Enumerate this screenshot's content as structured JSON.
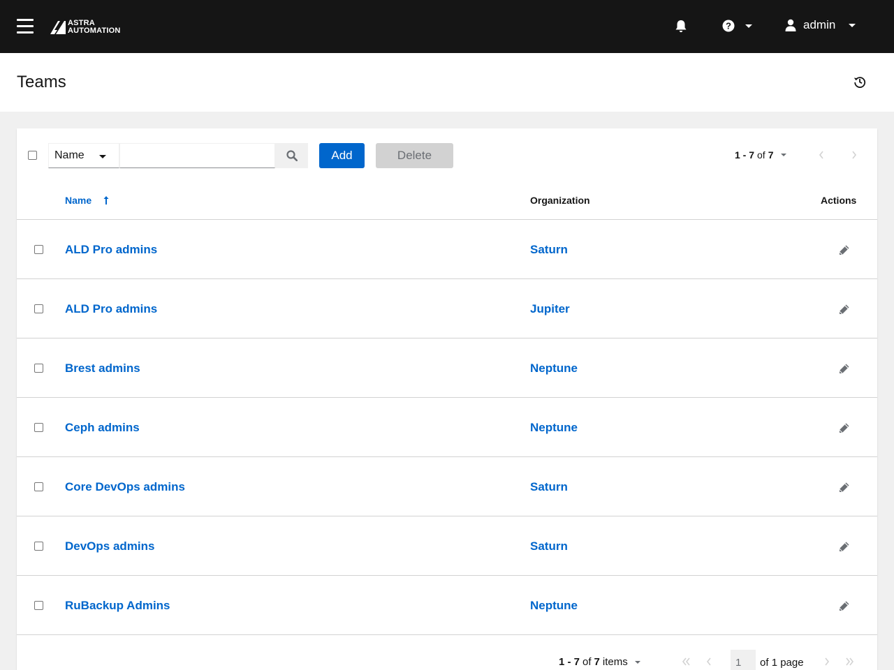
{
  "header": {
    "logo_line1": "ASTRA",
    "logo_line2": "AUTOMATION",
    "user_name": "admin",
    "icons": [
      "hamburger-icon",
      "bell-icon",
      "help-icon",
      "user-icon"
    ]
  },
  "page": {
    "title": "Teams"
  },
  "toolbar": {
    "filter_field": "Name",
    "search_placeholder": "",
    "add_label": "Add",
    "delete_label": "Delete",
    "pager_range": "1 - 7",
    "pager_of": "of",
    "pager_total": "7"
  },
  "table": {
    "columns": {
      "name": "Name",
      "organization": "Organization",
      "actions": "Actions"
    },
    "rows": [
      {
        "name": "ALD Pro admins",
        "organization": "Saturn"
      },
      {
        "name": "ALD Pro admins",
        "organization": "Jupiter"
      },
      {
        "name": "Brest admins",
        "organization": "Neptune"
      },
      {
        "name": "Ceph admins",
        "organization": "Neptune"
      },
      {
        "name": "Core DevOps admins",
        "organization": "Saturn"
      },
      {
        "name": "DevOps admins",
        "organization": "Saturn"
      },
      {
        "name": "RuBackup Admins",
        "organization": "Neptune"
      }
    ]
  },
  "pagination": {
    "range": "1 - 7",
    "of": "of",
    "total": "7",
    "items_label": "items",
    "current_page": "1",
    "of_page_pre": "of",
    "page_count": "1",
    "page_label": "page"
  },
  "colors": {
    "topbar": "#151515",
    "link": "#0066cc",
    "primary_button": "#0066cc",
    "disabled_button": "#d2d2d2"
  }
}
